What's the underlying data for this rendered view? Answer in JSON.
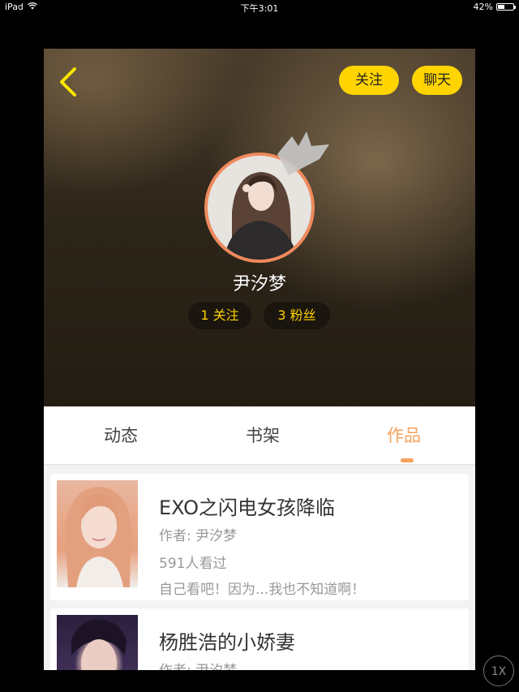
{
  "status_bar": {
    "device": "iPad",
    "time": "下午3:01",
    "battery_text": "42%",
    "battery_level": 0.42
  },
  "header": {
    "follow_button": "关注",
    "chat_button": "聊天",
    "username": "尹汐梦",
    "following_count": "1 关注",
    "fans_count": "3 粉丝"
  },
  "tabs": [
    {
      "label": "动态",
      "active": false
    },
    {
      "label": "书架",
      "active": false
    },
    {
      "label": "作品",
      "active": true
    }
  ],
  "works": [
    {
      "title": "EXO之闪电女孩降临",
      "author": "作者: 尹汐梦",
      "views": "591人看过",
      "description": "自己看吧！因为...我也不知道啊！"
    },
    {
      "title": "杨胜浩的小娇妻",
      "author": "作者: 尹汐梦"
    }
  ],
  "zoom_indicator": "1X",
  "colors": {
    "accent_yellow": "#ffd400",
    "active_tab": "#f5a25d",
    "avatar_border": "#f08a5d"
  }
}
